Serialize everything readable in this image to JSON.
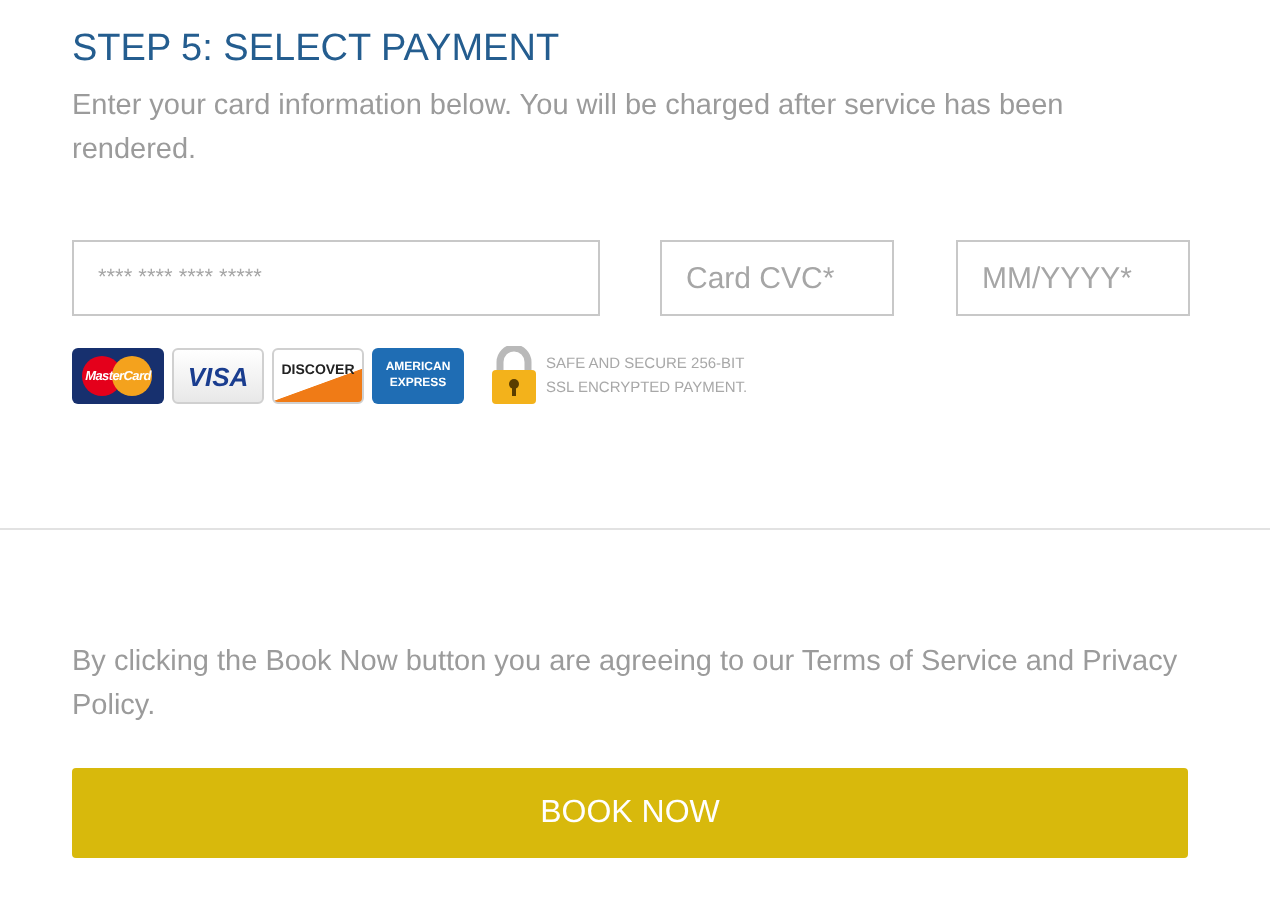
{
  "heading": "STEP 5: SELECT PAYMENT",
  "description": "Enter your card information below. You will be charged after service has been rendered.",
  "fields": [
    {
      "kind": "wide",
      "placeholder": "**** **** **** *****"
    },
    {
      "kind": "short",
      "placeholder": "Card CVC*"
    },
    {
      "kind": "short",
      "placeholder": "MM/YYYY*"
    }
  ],
  "cards": [
    {
      "kind": "mastercard",
      "label": "MasterCard"
    },
    {
      "kind": "visa",
      "label": "VISA"
    },
    {
      "kind": "discover",
      "label": "DISCOVER"
    },
    {
      "kind": "amex",
      "label": "AMERICAN EXPRESS"
    }
  ],
  "security_note": [
    "SAFE AND SECURE 256-BIT",
    "SSL ENCRYPTED PAYMENT."
  ],
  "terms": "By clicking the Book Now button you are agreeing to our Terms of Service and Privacy Policy.",
  "button": "BOOK NOW"
}
